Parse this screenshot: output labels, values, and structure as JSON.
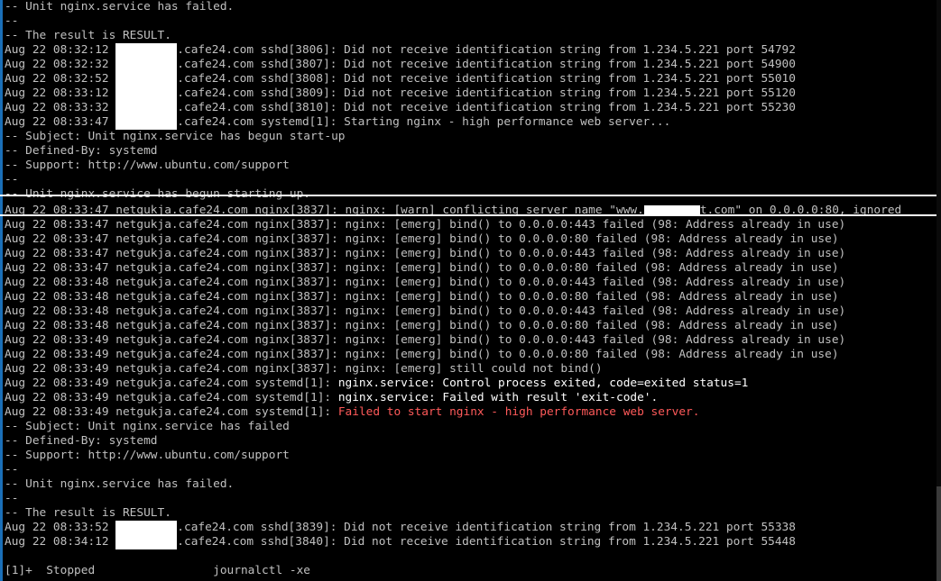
{
  "terminal": {
    "lines": [
      {
        "text": "-- Unit nginx.service has failed."
      },
      {
        "text": "--"
      },
      {
        "text": "-- The result is RESULT."
      },
      {
        "pre": "Aug 22 08:32:12 ",
        "post": ".cafe24.com sshd[3806]: Did not receive identification string from 1.234.5.221 port 54792"
      },
      {
        "pre": "Aug 22 08:32:32 ",
        "post": ".cafe24.com sshd[3807]: Did not receive identification string from 1.234.5.221 port 54900"
      },
      {
        "pre": "Aug 22 08:32:52 ",
        "post": ".cafe24.com sshd[3808]: Did not receive identification string from 1.234.5.221 port 55010"
      },
      {
        "pre": "Aug 22 08:33:12 ",
        "post": ".cafe24.com sshd[3809]: Did not receive identification string from 1.234.5.221 port 55120"
      },
      {
        "pre": "Aug 22 08:33:32 ",
        "post": ".cafe24.com sshd[3810]: Did not receive identification string from 1.234.5.221 port 55230"
      },
      {
        "pre": "Aug 22 08:33:47 ",
        "post": ".cafe24.com systemd[1]: Starting nginx - high performance web server..."
      },
      {
        "text": "-- Subject: Unit nginx.service has begun start-up"
      },
      {
        "text": "-- Defined-By: systemd"
      },
      {
        "text": "-- Support: http://www.ubuntu.com/support"
      },
      {
        "text": "--"
      },
      {
        "text": "-- Unit nginx.service has begun starting up."
      },
      {
        "pre": "Aug 22 08:33:47 netgukja.cafe24.com nginx[3837]: nginx: [warn] conflicting server name \"www.",
        "post": "t.com\" on 0.0.0.0:80, ignored",
        "redact": "small"
      },
      {
        "text": "Aug 22 08:33:47 netgukja.cafe24.com nginx[3837]: nginx: [emerg] bind() to 0.0.0.0:443 failed (98: Address already in use)"
      },
      {
        "text": "Aug 22 08:33:47 netgukja.cafe24.com nginx[3837]: nginx: [emerg] bind() to 0.0.0.0:80 failed (98: Address already in use)"
      },
      {
        "text": "Aug 22 08:33:47 netgukja.cafe24.com nginx[3837]: nginx: [emerg] bind() to 0.0.0.0:443 failed (98: Address already in use)"
      },
      {
        "text": "Aug 22 08:33:47 netgukja.cafe24.com nginx[3837]: nginx: [emerg] bind() to 0.0.0.0:80 failed (98: Address already in use)"
      },
      {
        "text": "Aug 22 08:33:48 netgukja.cafe24.com nginx[3837]: nginx: [emerg] bind() to 0.0.0.0:443 failed (98: Address already in use)"
      },
      {
        "text": "Aug 22 08:33:48 netgukja.cafe24.com nginx[3837]: nginx: [emerg] bind() to 0.0.0.0:80 failed (98: Address already in use)"
      },
      {
        "text": "Aug 22 08:33:48 netgukja.cafe24.com nginx[3837]: nginx: [emerg] bind() to 0.0.0.0:443 failed (98: Address already in use)"
      },
      {
        "text": "Aug 22 08:33:48 netgukja.cafe24.com nginx[3837]: nginx: [emerg] bind() to 0.0.0.0:80 failed (98: Address already in use)"
      },
      {
        "text": "Aug 22 08:33:49 netgukja.cafe24.com nginx[3837]: nginx: [emerg] bind() to 0.0.0.0:443 failed (98: Address already in use)"
      },
      {
        "text": "Aug 22 08:33:49 netgukja.cafe24.com nginx[3837]: nginx: [emerg] bind() to 0.0.0.0:80 failed (98: Address already in use)"
      },
      {
        "text": "Aug 22 08:33:49 netgukja.cafe24.com nginx[3837]: nginx: [emerg] still could not bind()"
      },
      {
        "pre": "Aug 22 08:33:49 netgukja.cafe24.com systemd[1]: ",
        "hl": "nginx.service: Control process exited, code=exited status=1",
        "hlstyle": "bright"
      },
      {
        "pre": "Aug 22 08:33:49 netgukja.cafe24.com systemd[1]: ",
        "hl": "nginx.service: Failed with result 'exit-code'.",
        "hlstyle": "bright"
      },
      {
        "pre": "Aug 22 08:33:49 netgukja.cafe24.com systemd[1]: ",
        "hl": "Failed to start nginx - high performance web server.",
        "hlstyle": "red"
      },
      {
        "text": "-- Subject: Unit nginx.service has failed"
      },
      {
        "text": "-- Defined-By: systemd"
      },
      {
        "text": "-- Support: http://www.ubuntu.com/support"
      },
      {
        "text": "--"
      },
      {
        "text": "-- Unit nginx.service has failed."
      },
      {
        "text": "--"
      },
      {
        "text": "-- The result is RESULT."
      },
      {
        "pre": "Aug 22 08:33:52 ",
        "post": ".cafe24.com sshd[3839]: Did not receive identification string from 1.234.5.221 port 55338"
      },
      {
        "pre": "Aug 22 08:34:12 ",
        "post": ".cafe24.com sshd[3840]: Did not receive identification string from 1.234.5.221 port 55448"
      },
      {
        "text": ""
      },
      {
        "text": "[1]+  Stopped                 journalctl -xe"
      }
    ]
  },
  "colors": {
    "text": "#c0c0c0",
    "bright": "#ffffff",
    "error": "#ff5a5a",
    "accent_bar": "#1a6fb8"
  }
}
